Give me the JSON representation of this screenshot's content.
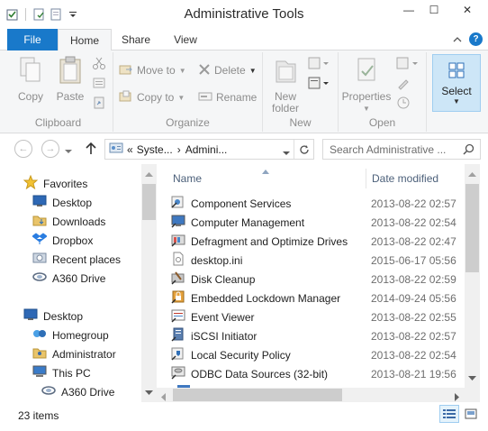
{
  "window": {
    "title": "Administrative Tools",
    "minimize": "—",
    "maximize": "☐",
    "close": "✕"
  },
  "ribbon_tabs": {
    "file": "File",
    "home": "Home",
    "share": "Share",
    "view": "View"
  },
  "ribbon": {
    "clipboard": {
      "label": "Clipboard",
      "copy": "Copy",
      "paste": "Paste"
    },
    "organize": {
      "label": "Organize",
      "move_to": "Move to",
      "copy_to": "Copy to",
      "delete": "Delete",
      "rename": "Rename"
    },
    "new": {
      "label": "New",
      "new_folder_line1": "New",
      "new_folder_line2": "folder"
    },
    "open": {
      "label": "Open",
      "properties": "Properties"
    },
    "select": {
      "label": "Select"
    }
  },
  "address": {
    "crumb_1": "Syste...",
    "crumb_2": "Admini...",
    "separator": "›",
    "prefix": "«"
  },
  "search": {
    "placeholder": "Search Administrative ..."
  },
  "nav_pane": {
    "favorites": "Favorites",
    "desktop": "Desktop",
    "downloads": "Downloads",
    "dropbox": "Dropbox",
    "recent_places": "Recent places",
    "a360_drive": "A360 Drive",
    "desktop_root": "Desktop",
    "homegroup": "Homegroup",
    "administrator": "Administrator",
    "this_pc": "This PC",
    "a360_drive_2": "A360 Drive"
  },
  "columns": {
    "name": "Name",
    "date_modified": "Date modified"
  },
  "files": [
    {
      "name": "Component Services",
      "date": "2013-08-22 02:57"
    },
    {
      "name": "Computer Management",
      "date": "2013-08-22 02:54"
    },
    {
      "name": "Defragment and Optimize Drives",
      "date": "2013-08-22 02:47"
    },
    {
      "name": "desktop.ini",
      "date": "2015-06-17 05:56"
    },
    {
      "name": "Disk Cleanup",
      "date": "2013-08-22 02:59"
    },
    {
      "name": "Embedded Lockdown Manager",
      "date": "2014-09-24 05:56"
    },
    {
      "name": "Event Viewer",
      "date": "2013-08-22 02:55"
    },
    {
      "name": "iSCSI Initiator",
      "date": "2013-08-22 02:57"
    },
    {
      "name": "Local Security Policy",
      "date": "2013-08-22 02:54"
    },
    {
      "name": "ODBC Data Sources (32-bit)",
      "date": "2013-08-21 19:56"
    }
  ],
  "status": {
    "item_count": "23 items"
  },
  "colors": {
    "accent": "#1979ca",
    "select_bg": "#cde6f7"
  }
}
